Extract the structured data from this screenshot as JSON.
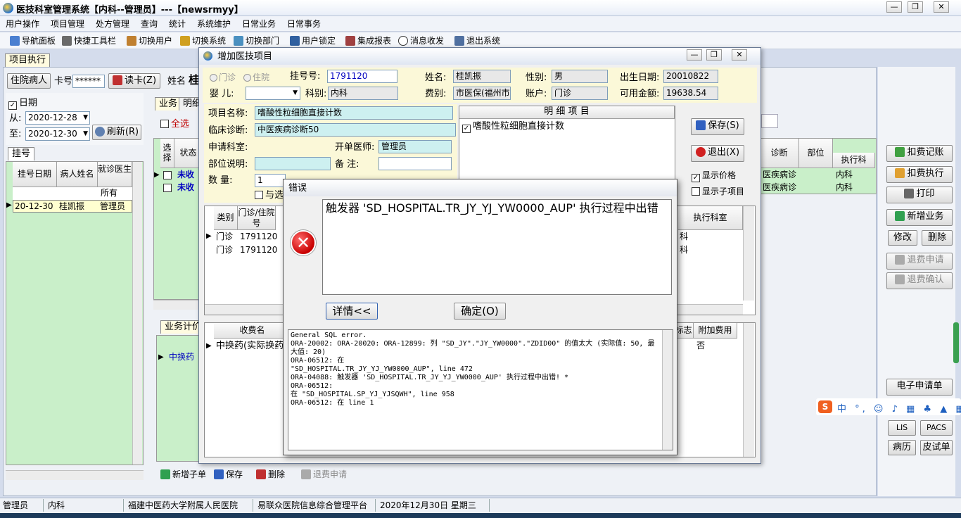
{
  "app": {
    "title": "医技科室管理系统【内科--管理员】---【newsrmyy】",
    "menu": [
      "用户操作",
      "项目管理",
      "处方管理",
      "查询",
      "统计",
      "系统维护",
      "日常业务",
      "日常事务"
    ],
    "toolbar": [
      "导航面板",
      "快捷工具栏",
      "切换用户",
      "切换系统",
      "切换部门",
      "用户锁定",
      "集成报表",
      "消息收发",
      "退出系统"
    ]
  },
  "main": {
    "tab_label": "项目执行",
    "patient_type_btn": "住院病人",
    "card_label": "卡号",
    "card_value": "******",
    "read_card_btn": "读卡(Z)",
    "name_label": "姓名",
    "name_value": "桂",
    "date_checkbox": "日期",
    "from_label": "从:",
    "from_date": "2020-12-28",
    "to_label": "至:",
    "to_date": "2020-12-30",
    "refresh_btn": "刷新(R)",
    "register_tab": "挂号",
    "reg_grid_headers": [
      "挂号日期",
      "病人姓名",
      "就诊医生"
    ],
    "reg_rows": [
      [
        "",
        "",
        "所有"
      ],
      [
        "20-12-30",
        "桂凯振",
        "管理员"
      ]
    ],
    "business_tabs": [
      "业务",
      "明细"
    ],
    "select_all": "全选",
    "biz_headers": [
      "选择",
      "状态"
    ],
    "biz_rows": [
      "未收",
      "未收"
    ],
    "right_headers": [
      "诊断",
      "部位",
      "执行科"
    ],
    "right_rows": [
      [
        "医疾病诊",
        "内科"
      ],
      [
        "医疾病诊",
        "内科"
      ]
    ],
    "pricing_tab": "业务计价",
    "pricing_row": "中换药",
    "bottom_buttons": [
      "新增子单",
      "保存",
      "删除",
      "退费申请"
    ]
  },
  "right_panel": {
    "buttons": [
      "扣费记账",
      "扣费执行",
      "打印",
      "新增业务",
      "修改",
      "删除",
      "退费申请",
      "退费确认",
      "电子申请单",
      "LIS",
      "PACS",
      "病历",
      "皮试单"
    ]
  },
  "dialog": {
    "title": "增加医技项目",
    "radio_outpatient": "门诊",
    "radio_inpatient": "住院",
    "reg_no_label": "挂号号:",
    "reg_no": "1791120",
    "name_label": "姓名:",
    "name": "桂凯振",
    "gender_label": "性别:",
    "gender": "男",
    "birth_label": "出生日期:",
    "birth": "20010822",
    "infant_label": "婴    儿:",
    "dept_label": "科别:",
    "dept": "内科",
    "fee_label": "费别:",
    "fee": "市医保(福州市",
    "account_label": "账户:",
    "account": "门诊",
    "balance_label": "可用金额:",
    "balance": "19638.54",
    "item_name_label": "项目名称:",
    "item_name": "嗜酸性粒细胞直接计数",
    "diagnosis_label": "临床诊断:",
    "diagnosis": "中医疾病诊断50",
    "apply_dept_label": "申请科室:",
    "doctor_label": "开单医师:",
    "doctor": "管理员",
    "site_label": "部位说明:",
    "remark_label": "备    注:",
    "qty_label": "数    量:",
    "qty": "1",
    "with_select": "与选",
    "detail_header": "明    细    项    目",
    "detail_item": "嗜酸性粒细胞直接计数",
    "save_btn": "保存(S)",
    "exit_btn": "退出(X)",
    "show_price": "显示价格",
    "show_subitem": "显示子项目",
    "grid_headers": [
      "类别",
      "门诊/住院号"
    ],
    "grid_rows": [
      [
        "门诊",
        "1791120"
      ],
      [
        "门诊",
        "1791120"
      ]
    ],
    "exec_dept_header": "执行科室",
    "exec_rows": [
      "科",
      "科"
    ],
    "lower_headers": [
      "收费名",
      "标志",
      "附加费用"
    ],
    "lower_row": [
      "中换药(实际换药",
      "否"
    ]
  },
  "error": {
    "title": "错误",
    "message": "触发器 'SD_HOSPITAL.TR_JY_YJ_YW0000_AUP' 执行过程中出错",
    "details_btn": "详情<<",
    "ok_btn": "确定(O)",
    "details": "General SQL error.\nORA-20002: ORA-20020: ORA-12899: 列 \"SD_JY\".\"JY_YW0000\".\"ZDID00\" 的值太大 (实际值: 50, 最大值: 20)\nORA-06512: 在\n\"SD_HOSPITAL.TR_JY_YJ_YW0000_AUP\", line 472\nORA-04088: 触发器 'SD_HOSPITAL.TR_JY_YJ_YW0000_AUP' 执行过程中出错! *\nORA-06512:\n在 \"SD_HOSPITAL.SP_YJ_YJSQWH\", line 958\nORA-06512: 在 line 1"
  },
  "statusbar": [
    "管理员",
    "内科",
    "福建中医药大学附属人民医院",
    "易联众医院信息综合管理平台",
    "2020年12月30日 星期三"
  ]
}
